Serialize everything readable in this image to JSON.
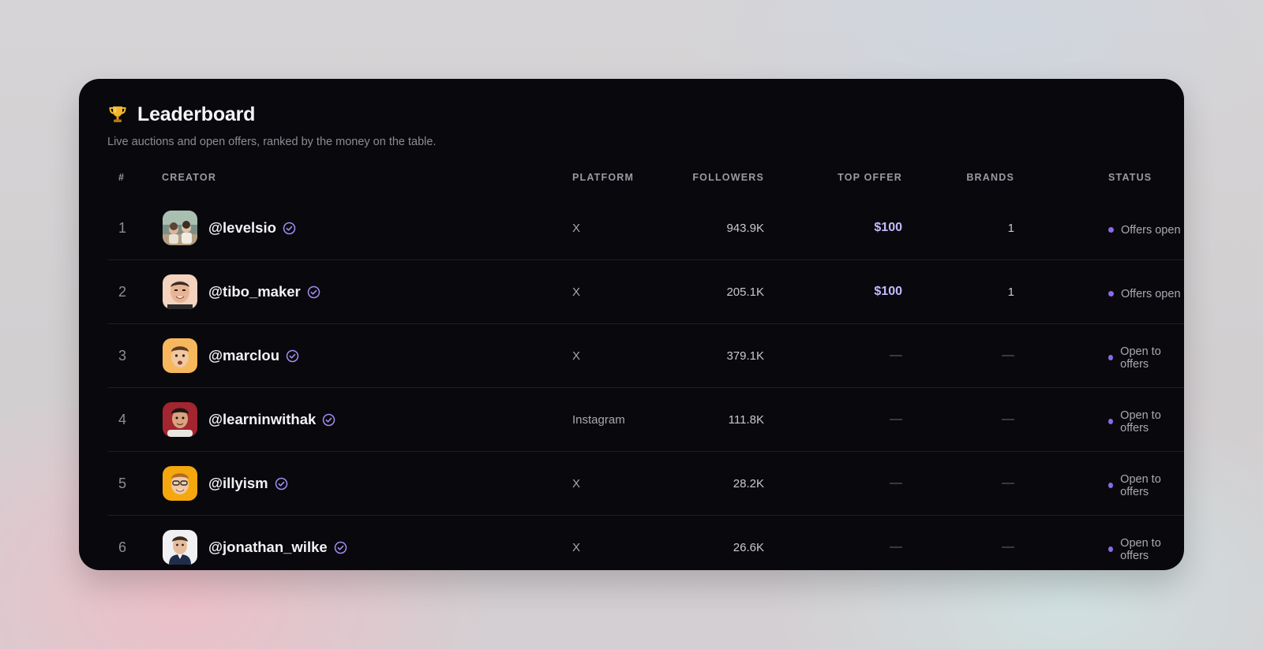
{
  "leaderboard": {
    "title": "Leaderboard",
    "subtitle": "Live auctions and open offers, ranked by the money on the table.",
    "title_icon": "trophy-icon"
  },
  "columns": {
    "rank": "#",
    "creator": "CREATOR",
    "platform": "PLATFORM",
    "followers": "FOLLOWERS",
    "top_offer": "TOP OFFER",
    "brands": "BRANDS",
    "status": "STATUS"
  },
  "rows": [
    {
      "rank": "1",
      "handle": "@levelsio",
      "platform": "X",
      "followers": "943.9K",
      "top_offer": "$100",
      "brands": "1",
      "status": "Offers open"
    },
    {
      "rank": "2",
      "handle": "@tibo_maker",
      "platform": "X",
      "followers": "205.1K",
      "top_offer": "$100",
      "brands": "1",
      "status": "Offers open"
    },
    {
      "rank": "3",
      "handle": "@marclou",
      "platform": "X",
      "followers": "379.1K",
      "top_offer": "—",
      "brands": "—",
      "status": "Open to offers"
    },
    {
      "rank": "4",
      "handle": "@learninwithak",
      "platform": "Instagram",
      "followers": "111.8K",
      "top_offer": "—",
      "brands": "—",
      "status": "Open to offers"
    },
    {
      "rank": "5",
      "handle": "@illyism",
      "platform": "X",
      "followers": "28.2K",
      "top_offer": "—",
      "brands": "—",
      "status": "Open to offers"
    },
    {
      "rank": "6",
      "handle": "@jonathan_wilke",
      "platform": "X",
      "followers": "26.6K",
      "top_offer": "—",
      "brands": "—",
      "status": "Open to offers"
    }
  ],
  "colors": {
    "card_background": "#09090d",
    "accent": "#c7b8ff",
    "status_dot": "#8c69ea",
    "verified_badge": "#a48cf0"
  }
}
